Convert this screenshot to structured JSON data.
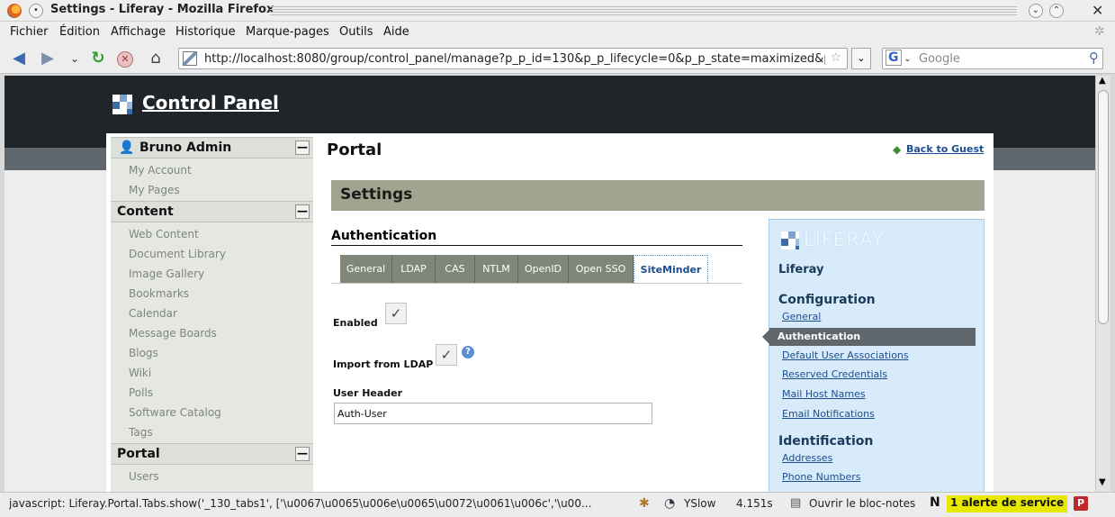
{
  "window": {
    "title": "Settings - Liferay - Mozilla Firefox"
  },
  "menubar": [
    "Fichier",
    "Édition",
    "Affichage",
    "Historique",
    "Marque-pages",
    "Outils",
    "Aide"
  ],
  "navbar": {
    "url": "http://localhost:8080/group/control_panel/manage?p_p_id=130&p_p_lifecycle=0&p_p_state=maximized&p_p_m",
    "search_placeholder": "Google",
    "search_engine_glyph": "G"
  },
  "header": {
    "title": "Control Panel"
  },
  "sidebar": {
    "user": {
      "name": "Bruno Admin",
      "items": [
        "My Account",
        "My Pages"
      ]
    },
    "content": {
      "title": "Content",
      "items": [
        "Web Content",
        "Document Library",
        "Image Gallery",
        "Bookmarks",
        "Calendar",
        "Message Boards",
        "Blogs",
        "Wiki",
        "Polls",
        "Software Catalog",
        "Tags"
      ]
    },
    "portal": {
      "title": "Portal",
      "items": [
        "Users"
      ]
    },
    "minimize_glyph": "—"
  },
  "main": {
    "portal_title": "Portal",
    "back_link": "Back to Guest",
    "settings_title": "Settings",
    "section_title": "Authentication",
    "tabs": [
      "General",
      "LDAP",
      "CAS",
      "NTLM",
      "OpenID",
      "Open SSO",
      "SiteMinder"
    ],
    "selected_tab": "SiteMinder",
    "fields": {
      "enabled_label": "Enabled",
      "enabled_checked": true,
      "import_label": "Import from LDAP",
      "import_checked": true,
      "user_header_label": "User Header",
      "user_header_value": "Auth-User"
    }
  },
  "right_panel": {
    "brand": "LIFERAY",
    "company": "Liferay",
    "configuration_title": "Configuration",
    "configuration_items": [
      "General",
      "Authentication",
      "Default User Associations",
      "Reserved Credentials",
      "Mail Host Names",
      "Email Notifications"
    ],
    "selected_item": "Authentication",
    "identification_title": "Identification",
    "identification_items": [
      "Addresses",
      "Phone Numbers"
    ]
  },
  "statusbar": {
    "message": "javascript: Liferay.Portal.Tabs.show('_130_tabs1', ['\\u0067\\u0065\\u006e\\u0065\\u0072\\u0061\\u006c','\\u00...",
    "yslow_label": "YSlow",
    "load_time": "4.151s",
    "notepad_label": "Ouvrir le bloc-notes",
    "alert_text": "1 alerte de service"
  },
  "colors": {
    "header_bg": "#1f2529",
    "settings_bar": "#9fa58f",
    "tab_bg": "#7f8779",
    "link": "#1d4e8f",
    "right_panel_bg": "#d7ebfa",
    "alert_bg": "#e8e800"
  }
}
